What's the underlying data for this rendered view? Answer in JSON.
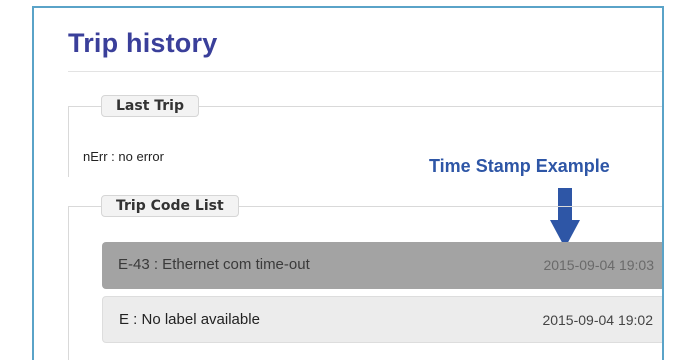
{
  "page": {
    "title": "Trip history"
  },
  "last_trip": {
    "legend": "Last Trip",
    "text": "nErr : no error"
  },
  "trip_code_list": {
    "legend": "Trip Code List",
    "rows": [
      {
        "label": "E-43 : Ethernet com time-out",
        "timestamp": "2015-09-04 19:03",
        "selected": true
      },
      {
        "label": "E : No label available",
        "timestamp": "2015-09-04 19:02",
        "selected": false
      }
    ]
  },
  "annotation": {
    "text": "Time Stamp Example",
    "color": "#2e56a6"
  },
  "colors": {
    "title": "#3a3f9a",
    "frame_border": "#5aa3c8",
    "selected_row": "#a3a3a3",
    "normal_row": "#ececec",
    "arrow": "#2e56a6"
  },
  "icons": {
    "annotation_arrow": "arrow-down-icon"
  }
}
